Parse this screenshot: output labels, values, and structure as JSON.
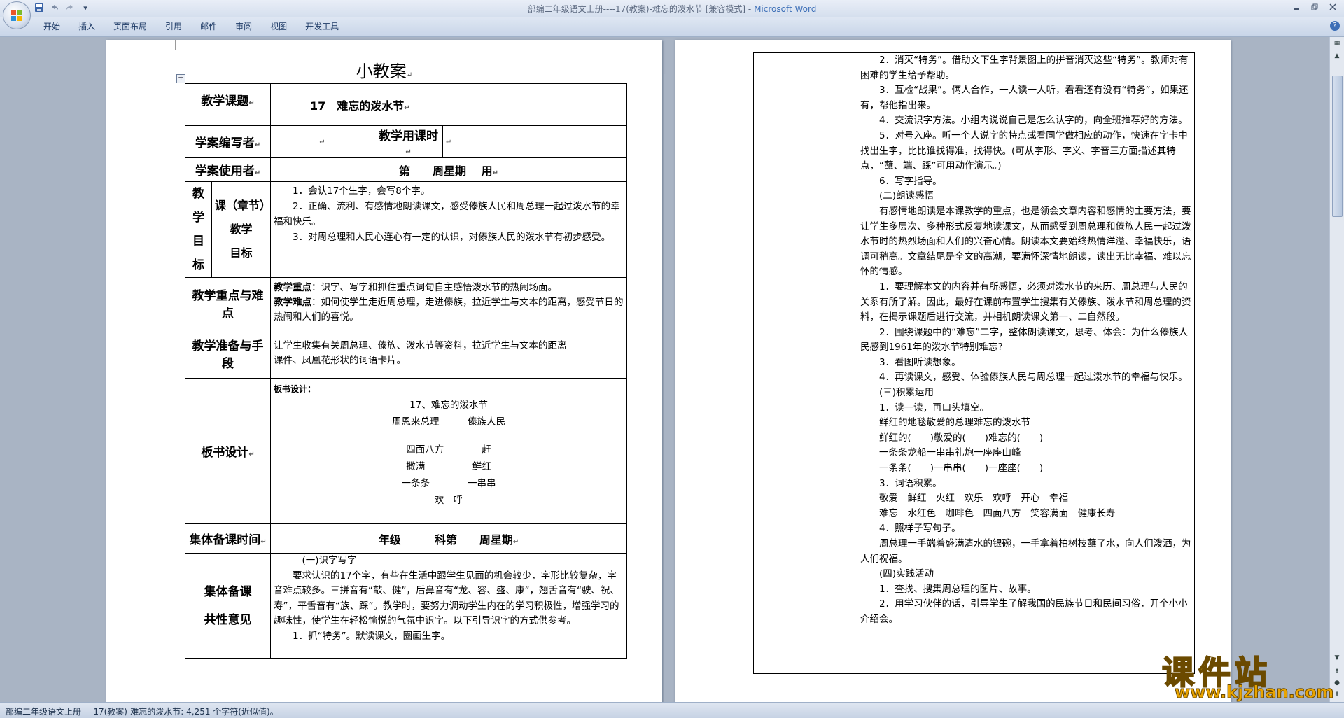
{
  "window": {
    "title_doc": "部编二年级语文上册----17(教案)-难忘的泼水节 [兼容模式] - ",
    "title_app": "Microsoft Word",
    "minimize_icon": "minimize-icon",
    "restore_icon": "restore-icon",
    "close_icon": "close-icon"
  },
  "quick_access": {
    "save": "save-icon",
    "undo": "undo-icon",
    "redo": "redo-icon",
    "customize": "▾"
  },
  "ribbon": {
    "tabs": [
      "开始",
      "插入",
      "页面布局",
      "引用",
      "邮件",
      "审阅",
      "视图",
      "开发工具"
    ],
    "help": "?"
  },
  "document": {
    "heading": "小教案",
    "table": {
      "topic_label": "教学课题",
      "topic_value": "17　难忘的泼水节",
      "author_label": "学案编写者",
      "author_value": "",
      "hours_label": "教学用课时",
      "hours_value": "",
      "user_label": "学案使用者",
      "user_value": "第　　周星期　 用",
      "goals_outer_label": [
        "教",
        "学",
        "目",
        "标"
      ],
      "goals_inner_label": [
        "课（章节）",
        "教学",
        "目标"
      ],
      "goals": [
        "　　1．会认17个生字，会写8个字。",
        "　　2．正确、流利、有感情地朗读课文，感受傣族人民和周总理一起过泼水节的幸福和快乐。",
        "　　3．对周总理和人民心连心有一定的认识，对傣族人民的泼水节有初步感受。"
      ],
      "key_label": "教学重点与难点",
      "key_point_title": "教学重点",
      "key_point": "：识字、写字和抓住重点词句自主感悟泼水节的热闹场面。",
      "difficulty_title": "教学难点",
      "difficulty": "：如何使学生走近周总理，走进傣族，拉近学生与文本的距离，感受节日的热闹和人们的喜悦。",
      "prep_label": "教学准备与手段",
      "prep": [
        "让学生收集有关周总理、傣族、泼水节等资料，拉近学生与文本的距离",
        "课件、凤凰花形状的词语卡片。"
      ],
      "board_label": "板书设计",
      "board_title": "板书设计：",
      "board_lines": [
        "17、难忘的泼水节",
        "周恩来总理　　　傣族人民",
        "",
        "四面八方　　　　赶",
        "撒满　　　　　鲜红",
        "一条条　　　　一串串",
        "欢　呼"
      ],
      "group_time_label": "集体备课时间",
      "group_time_value": "年级　　　科第　　周星期",
      "group_opinion_label": [
        "集体备课",
        "共性意见"
      ],
      "group_opinion": [
        "　　　(一)识字写字",
        "　　要求认识的17个字，有些在生活中跟学生见面的机会较少，字形比较复杂，字音难点较多。三拼音有“敲、健”，后鼻音有“龙、容、盛、康”，翘舌音有“驶、祝、寿”，平舌音有“族、踩”。教学时，要努力调动学生内在的学习积极性，增强学习的趣味性，使学生在轻松愉悦的气氛中识字。以下引导识字的方式供参考。",
        "　　1．抓“特务”。默读课文，圈画生字。"
      ]
    },
    "right_page": [
      "　　2．消灭“特务”。借助文下生字背景图上的拼音消灭这些“特务”。教师对有困难的学生给予帮助。",
      "　　3．互检“战果”。俩人合作，一人读一人听，看看还有没有“特务”，如果还有，帮他指出来。",
      "　　4．交流识字方法。小组内说说自己是怎么认字的，向全班推荐好的方法。",
      "　　5．对号入座。听一个人说字的特点或看同学做相应的动作，快速在字卡中找出生字，比比谁找得准，找得快。(可从字形、字义、字音三方面描述其特点，“蘸、端、踩”可用动作演示。)",
      "　　6．写字指导。",
      "　　(二)朗读感悟",
      "　　有感情地朗读是本课教学的重点，也是领会文章内容和感情的主要方法，要让学生多层次、多种形式反复地读课文，从而感受到周总理和傣族人民一起过泼水节时的热烈场面和人们的兴奋心情。朗读本文要始终热情洋溢、幸福快乐，语调可稍高。文章结尾是全文的高潮，要满怀深情地朗读，读出无比幸福、难以忘怀的情感。",
      "　　1．要理解本文的内容并有所感悟，必须对泼水节的来历、周总理与人民的关系有所了解。因此，最好在课前布置学生搜集有关傣族、泼水节和周总理的资料，在揭示课题后进行交流，并相机朗读课文第一、二自然段。",
      "　　2．围绕课题中的“难忘”二字，整体朗读课文，思考、体会：为什么傣族人民感到1961年的泼水节特别难忘?",
      "　　3．看图听读想象。",
      "　　4．再读课文，感受、体验傣族人民与周总理一起过泼水节的幸福与快乐。",
      "　　(三)积累运用",
      "　　1．读一读，再口头填空。",
      "　　鲜红的地毯敬爱的总理难忘的泼水节",
      "　　鲜红的(　　)敬爱的(　　)难忘的(　　)",
      "　　一条条龙船一串串礼炮一座座山峰",
      "　　一条条(　　)一串串(　　)一座座(　　)",
      "　　3．词语积累。",
      "　　敬爱　鲜红　火红　欢乐　欢呼　开心　幸福",
      "　　难忘　水红色　咖啡色　四面八方　笑容满面　健康长寿",
      "　　4．照样子写句子。",
      "　　周总理一手端着盛满清水的银碗，一手拿着柏树枝蘸了水，向人们泼洒，为人们祝福。",
      "　　(四)实践活动",
      "　　1．查找、搜集周总理的图片、故事。",
      "　　2．用学习伙伴的话，引导学生了解我国的民族节日和民间习俗，开个小小介绍会。"
    ]
  },
  "statusbar": {
    "text": "部编二年级语文上册----17(教案)-难忘的泼水节: 4,251 个字符(近似值)。"
  },
  "watermark": {
    "main": "课件站",
    "url": "www.kjzhan.com"
  }
}
